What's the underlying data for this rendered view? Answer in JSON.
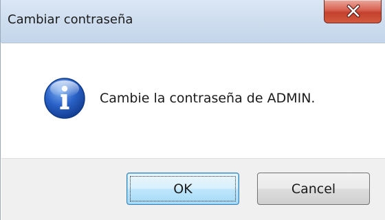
{
  "window": {
    "title": "Cambiar contraseña"
  },
  "titlebar": {
    "close_icon": "close-icon"
  },
  "content": {
    "icon": "info-icon",
    "message": "Cambie la contraseña de ADMIN."
  },
  "buttons": {
    "ok_label": "OK",
    "cancel_label": "Cancel"
  },
  "colors": {
    "titlebar": "#cfdeef",
    "close_button": "#c4402d",
    "info_icon": "#2255b8",
    "footer": "#f0f0f0",
    "default_button_border": "#3c7fb1"
  }
}
